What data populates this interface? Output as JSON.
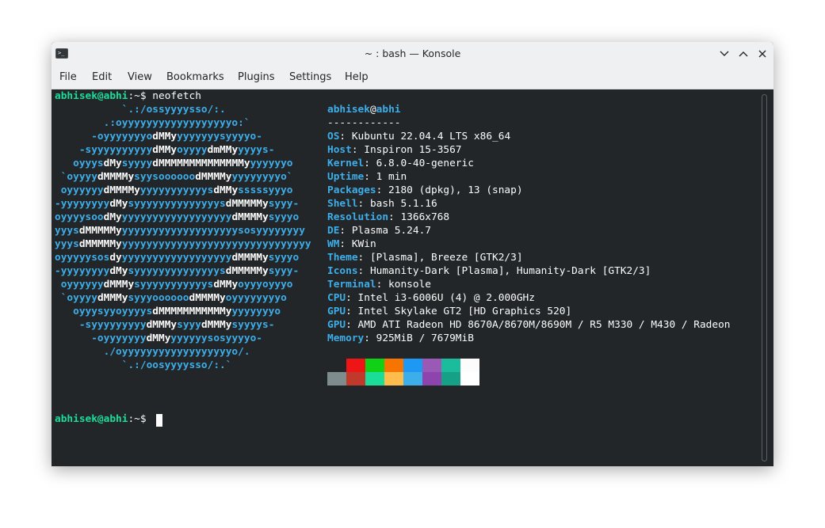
{
  "window": {
    "title": "~ : bash — Konsole"
  },
  "menu": [
    "File",
    "Edit",
    "View",
    "Bookmarks",
    "Plugins",
    "Settings",
    "Help"
  ],
  "prompt": {
    "user": "abhisek@abhi",
    "sep": ":~$",
    "command": "neofetch"
  },
  "logo": [
    [
      [
        "b",
        "           `.:/ossyyyysso/:."
      ]
    ],
    [
      [
        "b",
        "        .:oyyyyyyyyyyyyyyyyyyo:`"
      ]
    ],
    [
      [
        "b",
        "      -oyyyyyyyo"
      ],
      [
        "w",
        "dMMy"
      ],
      [
        "b",
        "yyyyyyysyyyyo-"
      ]
    ],
    [
      [
        "b",
        "    -syyyyyyyyyy"
      ],
      [
        "w",
        "dMMy"
      ],
      [
        "b",
        "oyyyy"
      ],
      [
        "w",
        "dmMMy"
      ],
      [
        "b",
        "yyyys-"
      ]
    ],
    [
      [
        "b",
        "   oyyys"
      ],
      [
        "w",
        "dMy"
      ],
      [
        "b",
        "syyyy"
      ],
      [
        "w",
        "dMMMMMMMMMMMMMMy"
      ],
      [
        "b",
        "yyyyyyo"
      ]
    ],
    [
      [
        "b",
        " `oyyyy"
      ],
      [
        "w",
        "dMMMMy"
      ],
      [
        "b",
        "syysoooooo"
      ],
      [
        "w",
        "dMMMMy"
      ],
      [
        "b",
        "yyyyyyyyo`"
      ]
    ],
    [
      [
        "b",
        " oyyyyyy"
      ],
      [
        "w",
        "dMMMMy"
      ],
      [
        "b",
        "yyyyyyyyyyys"
      ],
      [
        "w",
        "dMMy"
      ],
      [
        "b",
        "sssssyyyo"
      ]
    ],
    [
      [
        "b",
        "-yyyyyyyy"
      ],
      [
        "w",
        "dMy"
      ],
      [
        "b",
        "syyyyyyyyyyyyyys"
      ],
      [
        "w",
        "dMMMMMy"
      ],
      [
        "b",
        "syyy-"
      ]
    ],
    [
      [
        "b",
        "oyyyysoo"
      ],
      [
        "w",
        "dMy"
      ],
      [
        "b",
        "yyyyyyyyyyyyyyyyyy"
      ],
      [
        "w",
        "dMMMMy"
      ],
      [
        "b",
        "syyyo"
      ]
    ],
    [
      [
        "b",
        "yyys"
      ],
      [
        "w",
        "dMMMMMy"
      ],
      [
        "b",
        "yyyyyyyyyyyyyyyyyyysosyyyyyyyy"
      ]
    ],
    [
      [
        "b",
        "yyys"
      ],
      [
        "w",
        "dMMMMMy"
      ],
      [
        "b",
        "yyyyyyyyyyyyyyyyyyyyyyyyyyyyyyy"
      ]
    ],
    [
      [
        "b",
        "oyyyyysos"
      ],
      [
        "w",
        "dy"
      ],
      [
        "b",
        "yyyyyyyyyyyyyyyyyy"
      ],
      [
        "w",
        "dMMMMy"
      ],
      [
        "b",
        "syyyo"
      ]
    ],
    [
      [
        "b",
        "-yyyyyyyy"
      ],
      [
        "w",
        "dMy"
      ],
      [
        "b",
        "syyyyyyyyyyyyyys"
      ],
      [
        "w",
        "dMMMMMy"
      ],
      [
        "b",
        "syyy-"
      ]
    ],
    [
      [
        "b",
        " oyyyyyy"
      ],
      [
        "w",
        "dMMMy"
      ],
      [
        "b",
        "syyyyyyyyyyys"
      ],
      [
        "w",
        "dMMy"
      ],
      [
        "b",
        "oyyyoyyyo"
      ]
    ],
    [
      [
        "b",
        " `oyyyy"
      ],
      [
        "w",
        "dMMMy"
      ],
      [
        "b",
        "syyyoooooo"
      ],
      [
        "w",
        "dMMMMy"
      ],
      [
        "b",
        "oyyyyyyyyo"
      ]
    ],
    [
      [
        "b",
        "   oyyysyyoyyyys"
      ],
      [
        "w",
        "dMMMMMMMMMMMy"
      ],
      [
        "b",
        "yyyyyyyo"
      ]
    ],
    [
      [
        "b",
        "    -syyyyyyyyy"
      ],
      [
        "w",
        "dMMMy"
      ],
      [
        "b",
        "syyy"
      ],
      [
        "w",
        "dMMMy"
      ],
      [
        "b",
        "syyyys-"
      ]
    ],
    [
      [
        "b",
        "      -oyyyyyyy"
      ],
      [
        "w",
        "dMMy"
      ],
      [
        "b",
        "yyyyyysosyyyyo-"
      ]
    ],
    [
      [
        "b",
        "        ./oyyyyyyyyyyyyyyyyyyo/."
      ]
    ],
    [
      [
        "b",
        "           `.:/oosyyyysso/:.`"
      ]
    ]
  ],
  "info": {
    "user": "abhisek",
    "at": "@",
    "host": "abhi",
    "separator": "------------",
    "rows": [
      {
        "key": "OS",
        "value": ": Kubuntu 22.04.4 LTS x86_64"
      },
      {
        "key": "Host",
        "value": ": Inspiron 15-3567"
      },
      {
        "key": "Kernel",
        "value": ": 6.8.0-40-generic"
      },
      {
        "key": "Uptime",
        "value": ": 1 min"
      },
      {
        "key": "Packages",
        "value": ": 2180 (dpkg), 13 (snap)"
      },
      {
        "key": "Shell",
        "value": ": bash 5.1.16"
      },
      {
        "key": "Resolution",
        "value": ": 1366x768"
      },
      {
        "key": "DE",
        "value": ": Plasma 5.24.7"
      },
      {
        "key": "WM",
        "value": ": KWin"
      },
      {
        "key": "Theme",
        "value": ": [Plasma], Breeze [GTK2/3]"
      },
      {
        "key": "Icons",
        "value": ": Humanity-Dark [Plasma], Humanity-Dark [GTK2/3]"
      },
      {
        "key": "Terminal",
        "value": ": konsole"
      },
      {
        "key": "CPU",
        "value": ": Intel i3-6006U (4) @ 2.000GHz"
      },
      {
        "key": "GPU",
        "value": ": Intel Skylake GT2 [HD Graphics 520]"
      },
      {
        "key": "GPU",
        "value": ": AMD ATI Radeon HD 8670A/8670M/8690M / R5 M330 / M430 / Radeon"
      },
      {
        "key": "Memory",
        "value": ": 925MiB / 7679MiB"
      }
    ]
  },
  "palette": {
    "top": [
      "#232629",
      "#ed1515",
      "#11d116",
      "#f67400",
      "#1d99f3",
      "#9b59b6",
      "#1abc9c",
      "#fcfcfc"
    ],
    "bottom": [
      "#7f8c8d",
      "#c0392b",
      "#1cdc9a",
      "#fdbc4b",
      "#3daee9",
      "#8e44ad",
      "#16a085",
      "#ffffff"
    ]
  },
  "prompt2": {
    "user": "abhisek@abhi",
    "sep": ":~$"
  },
  "icons": {
    "app": "terminal-icon",
    "minimize": "chevron-down-icon",
    "maximize": "chevron-up-icon",
    "close": "close-icon"
  }
}
